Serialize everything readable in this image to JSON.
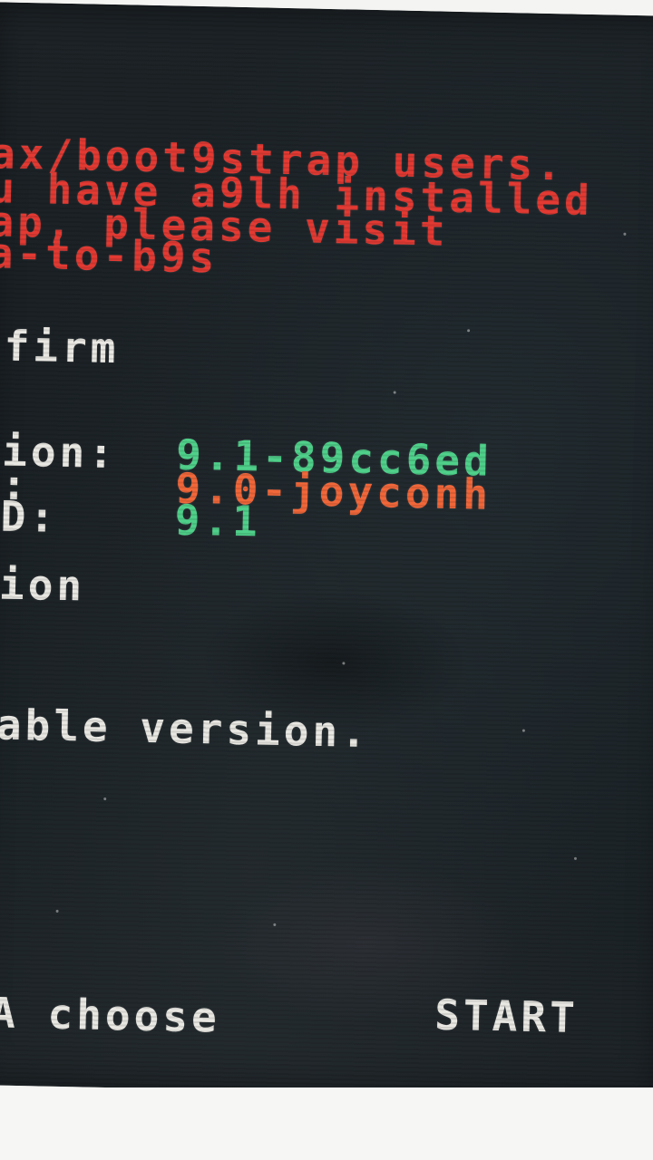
{
  "notice": {
    "line1": "ax/boot9strap users.",
    "line2": "u have a9lh installed",
    "line3": "ap, please visit",
    "line4": "a-to-b9s"
  },
  "menu": {
    "firm_label": "firm",
    "version_label": "ion:",
    "version_value": "9.1-89cc6ed",
    "second_label": ":",
    "second_value": "9.0-joyconh",
    "third_label": "D:",
    "third_value": "9.1",
    "option_label": "ion",
    "status_text": "able version.",
    "footer_left": "A choose",
    "footer_right": "START"
  },
  "colors": {
    "screen_bg": "#1b2226",
    "notice_red": "#e23a33",
    "text_white": "#e9e7e2",
    "value_green": "#4fd08a",
    "value_orange": "#f0673a"
  }
}
